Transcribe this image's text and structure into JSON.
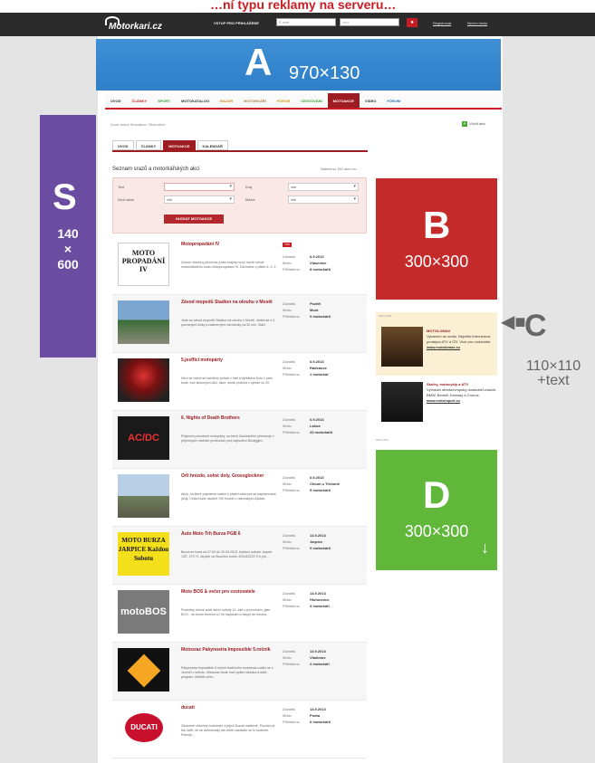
{
  "header_title": "…ní typu reklamy na serveru…",
  "logo": "Motorkari.cz",
  "login": {
    "label": "VSTUP PRO PŘIHLÁŠENÉ",
    "email_placeholder": "E-mail",
    "password_placeholder": "•••••",
    "register": "Registrovat",
    "forgot": "Nevím heslo"
  },
  "ads": {
    "A": {
      "letter": "A",
      "dim": "970×130"
    },
    "B": {
      "letter": "B",
      "dim": "300×300"
    },
    "C": {
      "letter": "C",
      "dim": "110×110 +text",
      "label": "REKLAMA"
    },
    "D": {
      "letter": "D",
      "dim": "300×300",
      "label": "REKLAMA"
    },
    "S": {
      "letter": "S",
      "dim_w": "140",
      "dim_x": "×",
      "dim_h": "600"
    }
  },
  "nav": [
    "ÚVOD",
    "ČLÁNKY",
    "SPORT",
    "MOTOKATALOG",
    "BAZAR",
    "MOTORKÁŘI",
    "FÓRUM",
    "CESTOVÁNÍ",
    "MOTOAKCE",
    "VIDEO",
    "FÓRUM"
  ],
  "breadcrumb": "Úvod sekce Motoakce  /  Motoakce",
  "topic_link": "Vložit akci",
  "subtabs": [
    "ÚVOD",
    "ČLÁNKY",
    "MOTOAKCE",
    "KALENDÁŘ"
  ],
  "heading": "Seznam srazů a motorkářských akcí",
  "count": "Nalezeno 194 akcí na...",
  "filter": {
    "f1": "Text",
    "f2": "Druh akce",
    "f2v": "vše",
    "f3": "Kraj",
    "f3v": "vše",
    "f4": "Měsíc",
    "f4v": "vše",
    "button": "HLEDAT MOTOAKCE"
  },
  "labels": {
    "start": "Začátek",
    "place": "Místo",
    "signed": "Přihlášeno"
  },
  "ad_items": [
    {
      "title": "MOTOLOMAX",
      "text": "Vybavení do sedla. Největší internetová prodejna ATV a ČR. Více pro motorkáře.",
      "url": "www.motolomax.cz"
    },
    {
      "title": "Skútry, motocykly a ATV",
      "text": "Výhradní středoevropský dodavatel značek BMW, Benelli, Keeway a Cronos",
      "url": "www.motorsport.cz"
    }
  ],
  "events": [
    {
      "title": "Motopropadání IV",
      "tag": "TOP",
      "desc": "Zveme všechny příznivce jízdní krajiny na již čtvrté ročník motorkářského srazu Motopropadání IV. Začínáme v pátek 6. 9. 2.",
      "date": "6.9.2013",
      "place": "Vlásenice",
      "signed": "8 motorkářů",
      "thumb": "MOTO PROPADÁNÍ IV"
    },
    {
      "title": "Závod mopedů Stadion na okruhu v Mostě",
      "desc": "Jede se závod mopedů Stadion na okruhu v Mostě. Jedeš se s 3 pozvanými kluky a nádhernými závodníky na 30 min. Start",
      "date": "Pozítří",
      "place": "Most",
      "signed": "0 motorkářů",
      "thumb": ""
    },
    {
      "title": "5.jesfficí motopárty",
      "desc": "Není se nutná se každého pořadí v trati a vyhlášení Kolo v páru bude více sfukových ulici, akce, seriál probíhá v sjezde ve 20.",
      "date": "6.9.2013",
      "place": "Radvance",
      "signed": "1 motorkář",
      "thumb": ""
    },
    {
      "title": "6. Nights of Death Brothers",
      "desc": "Příjemné pohodové motopárty, na které Zachráněné přenocuje v příjemných nádních prostorách pod zájezdem Bludýgjím.",
      "date": "6.9.2013",
      "place": "Lašna",
      "signed": "23 motorkářů",
      "thumb": "AC/DC"
    },
    {
      "title": "Orli hnízdo, solné doly, Grossglockner",
      "desc": "Akcji, na které pojedeme našim s přáteli zahrnout se naplánované jízdy. Cesta bude osudné Orli hnízdo v rakouských Alpách.",
      "date": "6.9.2013",
      "place": "Chlum u Třeboně",
      "signed": "5 motorkářů",
      "thumb": ""
    },
    {
      "title": "Auto Moto Trh Burza PGB 6",
      "desc": "Burza se koná od 07:00 do 30.09.2013. Každou sobotu Jarpice 13Č. 273 71 Jarpice za Sloučinu Ionek. 603343223 Trh pro...",
      "date": "14.9.2013",
      "place": "Jarpice",
      "signed": "0 motorkářů",
      "thumb": "MOTO BURZA JARPICE Každou Sobotu"
    },
    {
      "title": "Moto BOS & večer pro cestovatele",
      "desc": "Posledný ročník sudé akční soboty 14. září v pozvolném, jako BOS - na tomto termínu si i ke kaplanim a zaspít do mnoha...",
      "date": "14.9.2013",
      "place": "Hlohovnice",
      "signed": "3 motorkáři",
      "thumb": "motoBOS"
    },
    {
      "title": "Motosraz Pakynostra Impossible 5.ročník",
      "desc": "Pakynostra Impossible 5.ročník tradičního motosrazu našlo se s Jezevřt v sobotu. Motosraz bude mat vydání tabulka a další program. Můžete přes...",
      "date": "14.9.2013",
      "place": "Vlašimov",
      "signed": "2 motorkáři",
      "thumb": ""
    },
    {
      "title": "ducati",
      "desc": "Zdravíme všechny motorkáře a jejich Ducati nadšené. Pozvaní je tak vidět, že se dohromady tak velké zastávku se to budeme. Plánuje...",
      "date": "14.9.2013",
      "place": "Praha",
      "signed": "6 motorkářů",
      "thumb": "DUCATI"
    }
  ]
}
